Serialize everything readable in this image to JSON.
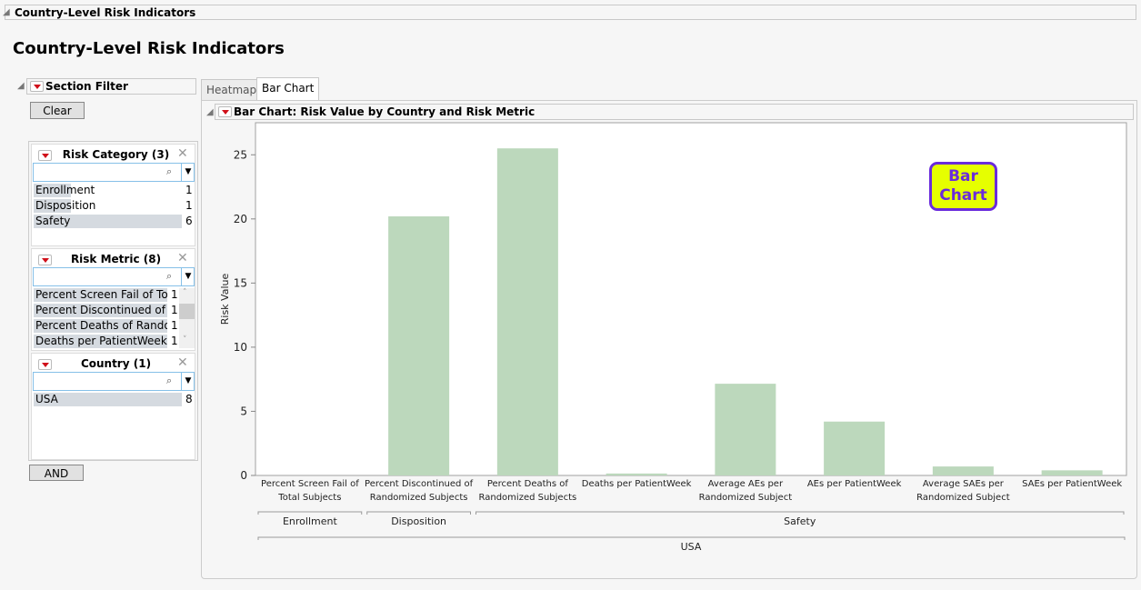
{
  "window": {
    "outline_title": "Country-Level Risk Indicators",
    "page_title": "Country-Level Risk Indicators"
  },
  "filter": {
    "title": "Section Filter",
    "clear_label": "Clear",
    "and_label": "AND",
    "panels": [
      {
        "title": "Risk Category (3)",
        "search_placeholder": "",
        "items": [
          {
            "label": "Enrollment",
            "count": "1",
            "fill": 0.25
          },
          {
            "label": "Disposition",
            "count": "1",
            "fill": 0.25
          },
          {
            "label": "Safety",
            "count": "6",
            "fill": 1
          }
        ]
      },
      {
        "title": "Risk Metric (8)",
        "search_placeholder": "",
        "items": [
          {
            "label": "Percent Screen Fail of Tot...",
            "count": "1",
            "fill": 1
          },
          {
            "label": "Percent Discontinued of R...",
            "count": "1",
            "fill": 1
          },
          {
            "label": "Percent Deaths of Rando...",
            "count": "1",
            "fill": 1
          },
          {
            "label": "Deaths per PatientWeek",
            "count": "1",
            "fill": 1
          }
        ]
      },
      {
        "title": "Country (1)",
        "search_placeholder": "",
        "items": [
          {
            "label": "USA",
            "count": "8",
            "fill": 1
          }
        ]
      }
    ]
  },
  "tabs": [
    {
      "label": "Heatmap",
      "active": false
    },
    {
      "label": "Bar Chart",
      "active": true
    }
  ],
  "chart_panel": {
    "title": "Bar Chart: Risk Value by Country and Risk Metric",
    "badge_line1": "Bar",
    "badge_line2": "Chart"
  },
  "chart_data": {
    "type": "bar",
    "ylabel": "Risk Value",
    "ylim": [
      0,
      27.5
    ],
    "yticks": [
      0,
      5,
      10,
      15,
      20,
      25
    ],
    "bar_color": "#bcd8bc",
    "grid": false,
    "categories": [
      [
        "Percent Screen Fail of",
        "Total Subjects"
      ],
      [
        "Percent Discontinued of",
        "Randomized Subjects"
      ],
      [
        "Percent Deaths of",
        "Randomized Subjects"
      ],
      [
        "Deaths per PatientWeek"
      ],
      [
        "Average AEs per",
        "Randomized Subject"
      ],
      [
        "AEs per PatientWeek"
      ],
      [
        "Average SAEs per",
        "Randomized Subject"
      ],
      [
        "SAEs per PatientWeek"
      ]
    ],
    "values": [
      0,
      20.2,
      25.5,
      0.15,
      7.15,
      4.2,
      0.7,
      0.4
    ],
    "groups": [
      {
        "label": "Enrollment",
        "span": [
          0,
          0
        ]
      },
      {
        "label": "Disposition",
        "span": [
          1,
          1
        ]
      },
      {
        "label": "Safety",
        "span": [
          2,
          7
        ]
      }
    ],
    "outer_group": "USA"
  }
}
